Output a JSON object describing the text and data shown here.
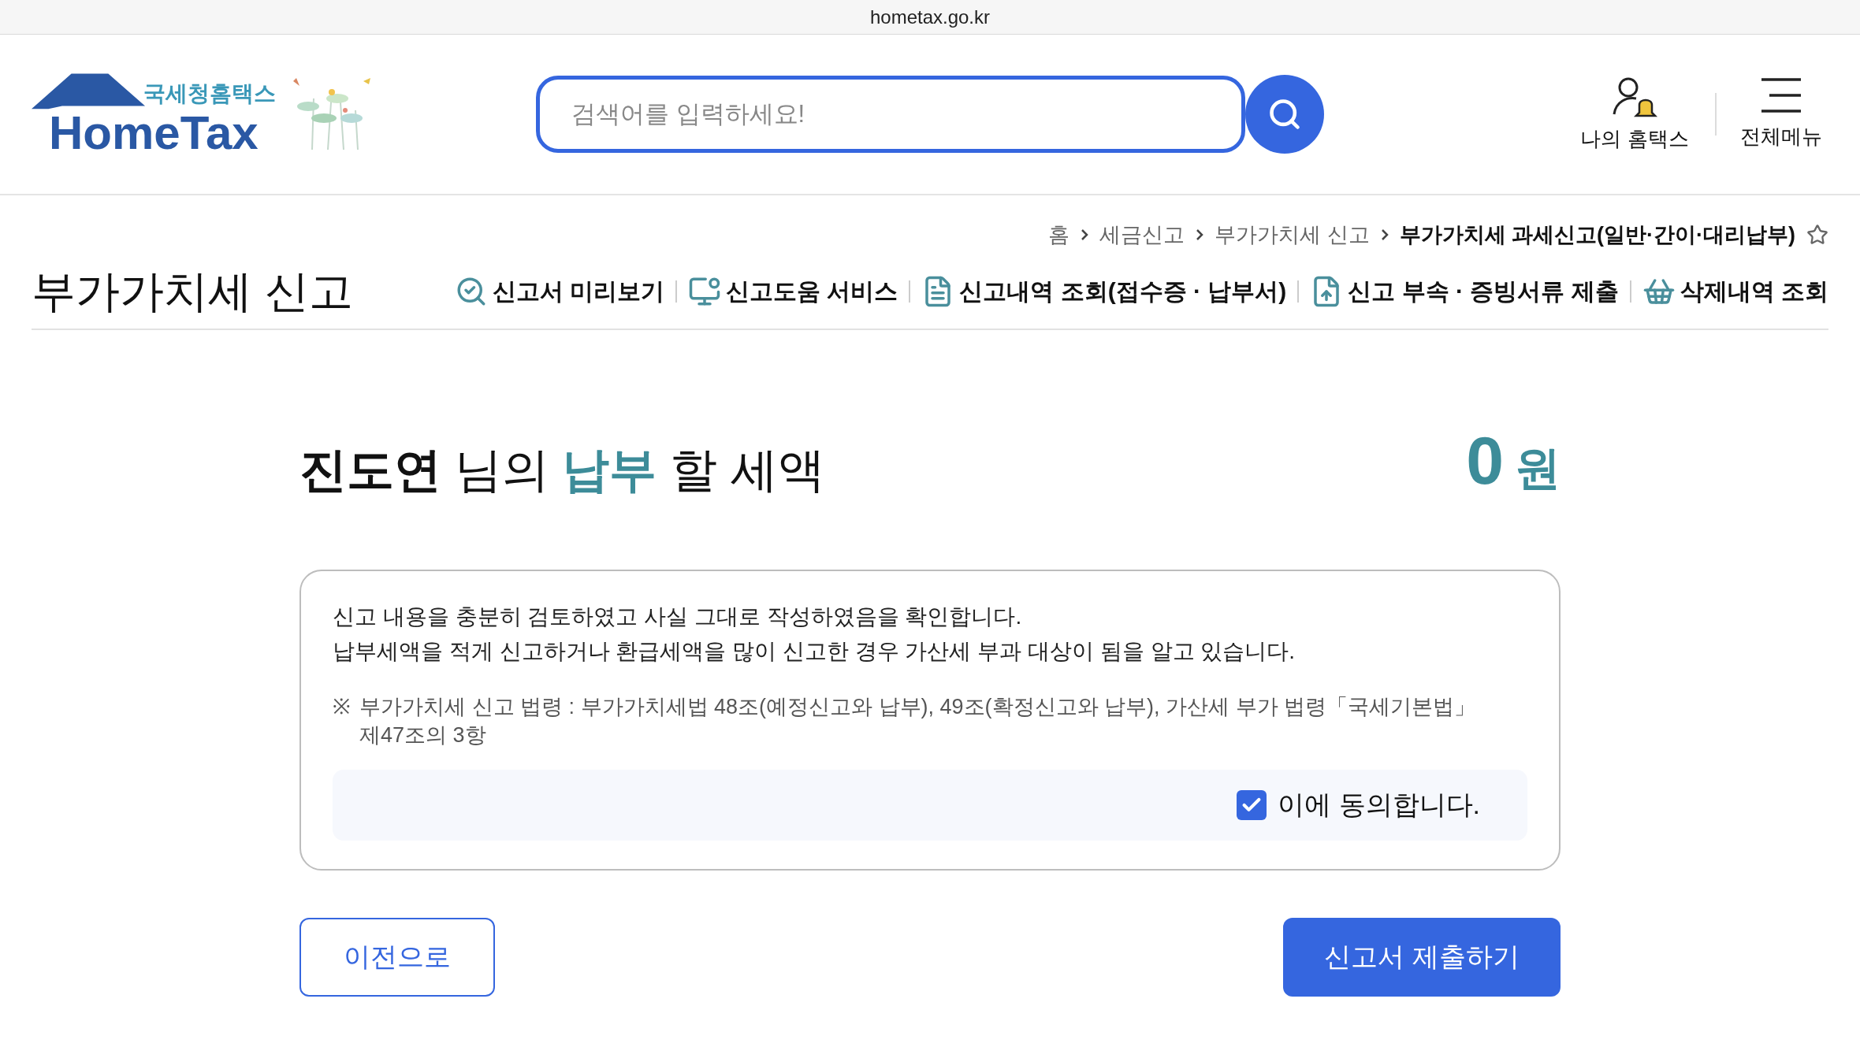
{
  "address_bar": {
    "url": "hometax.go.kr"
  },
  "header": {
    "logo": {
      "subtitle": "국세청홈택스",
      "title": "HomeTax"
    },
    "search": {
      "placeholder": "검색어를 입력하세요!"
    },
    "actions": [
      "나의 홈택스",
      "전체메뉴"
    ]
  },
  "breadcrumb": {
    "items": [
      "홈",
      "세금신고",
      "부가가치세 신고",
      "부가가치세 과세신고(일반·간이·대리납부)"
    ],
    "favorite": false
  },
  "page_title": "부가가치세 신고",
  "quick_links": [
    "신고서 미리보기",
    "신고도움 서비스",
    "신고내역 조회(접수증 · 납부서)",
    "신고 부속 · 증빙서류 제출",
    "삭제내역 조회"
  ],
  "summary": {
    "heading": [
      {
        "kind": "name",
        "text": "진도연"
      },
      {
        "kind": "plain",
        "text": "님의"
      },
      {
        "kind": "highlight",
        "text": "납부"
      },
      {
        "kind": "plain",
        "text": "할 세액"
      }
    ],
    "amount": "0",
    "unit": "원"
  },
  "confirmation": {
    "lines": [
      "신고 내용을 충분히 검토하였고 사실 그대로 작성하였음을 확인합니다.",
      "납부세액을 적게 신고하거나 환급세액을 많이 신고한 경우 가산세 부과 대상이 됨을 알고 있습니다."
    ],
    "note_mark": "※",
    "note": "부가가치세 신고 법령 :  부가가치세법 48조(예정신고와 납부), 49조(확정신고와 납부), 가산세 부가 법령「국세기본법」 제47조의 3항",
    "agree": {
      "label": "이에 동의합니다.",
      "checked": true
    }
  },
  "buttons": {
    "back": "이전으로",
    "submit": "신고서 제출하기"
  }
}
